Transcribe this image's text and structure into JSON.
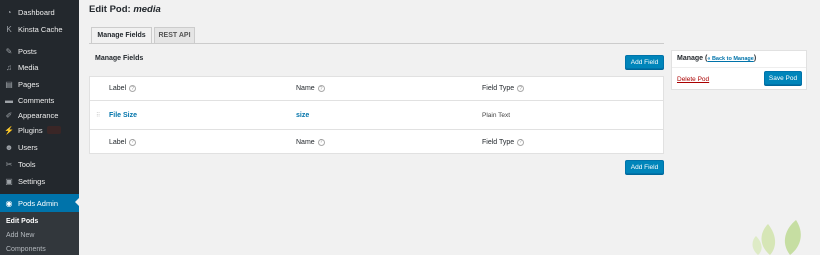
{
  "sidebar": {
    "items": [
      {
        "label": "Dashboard",
        "icon": "dashboard-icon"
      },
      {
        "label": "Kinsta Cache",
        "icon": "kinsta-icon"
      },
      {
        "label": "Posts",
        "icon": "pin-icon"
      },
      {
        "label": "Media",
        "icon": "media-icon"
      },
      {
        "label": "Pages",
        "icon": "pages-icon"
      },
      {
        "label": "Comments",
        "icon": "comments-icon"
      },
      {
        "label": "Appearance",
        "icon": "brush-icon"
      },
      {
        "label": "Plugins",
        "icon": "plugin-icon"
      },
      {
        "label": "Users",
        "icon": "users-icon"
      },
      {
        "label": "Tools",
        "icon": "wrench-icon"
      },
      {
        "label": "Settings",
        "icon": "settings-icon"
      },
      {
        "label": "Pods Admin",
        "icon": "pods-icon"
      }
    ],
    "submenu": [
      "Edit Pods",
      "Add New",
      "Components"
    ]
  },
  "header": {
    "title_prefix": "Edit Pod: ",
    "title_pod": "media"
  },
  "tabs": [
    "Manage Fields",
    "REST API"
  ],
  "main": {
    "section_title": "Manage Fields",
    "add_field_label": "Add Field",
    "columns": {
      "label": "Label",
      "name": "Name",
      "type": "Field Type",
      "help": "?"
    },
    "rows": [
      {
        "label": "File Size",
        "name": "size",
        "type": "Plain Text"
      }
    ]
  },
  "manage": {
    "title": "Manage",
    "back_link": "« Back to Manage",
    "delete_label": "Delete Pod",
    "save_label": "Save Pod"
  },
  "colors": {
    "accent": "#0073aa",
    "sidebar": "#23282d",
    "delete": "#aa0000"
  }
}
